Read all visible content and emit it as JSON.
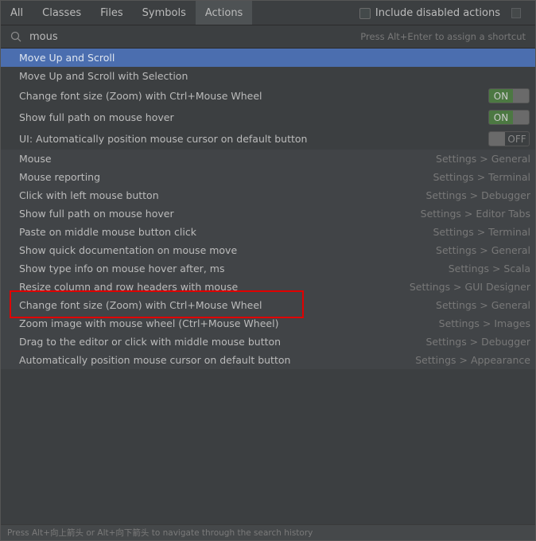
{
  "tabs": [
    "All",
    "Classes",
    "Files",
    "Symbols",
    "Actions"
  ],
  "active_tab": "Actions",
  "include_disabled": {
    "label": "Include disabled actions",
    "checked": false
  },
  "search": {
    "value": "mous",
    "hint": "Press Alt+Enter to assign a shortcut"
  },
  "actions": [
    {
      "label": "Move Up and Scroll",
      "selected": true
    },
    {
      "label": "Move Up and Scroll with Selection"
    },
    {
      "label": "Change font size (Zoom) with Ctrl+Mouse Wheel",
      "toggle": "ON"
    },
    {
      "label": "Show full path on mouse hover",
      "toggle": "ON"
    },
    {
      "label": "UI: Automatically position mouse cursor on default button",
      "toggle": "OFF"
    }
  ],
  "settings": [
    {
      "label": "Mouse",
      "location": "Settings > General"
    },
    {
      "label": "Mouse reporting",
      "location": "Settings > Terminal"
    },
    {
      "label": "Click with left mouse button",
      "location": "Settings > Debugger"
    },
    {
      "label": "Show full path on mouse hover",
      "location": "Settings > Editor Tabs"
    },
    {
      "label": "Paste on middle mouse button click",
      "location": "Settings > Terminal"
    },
    {
      "label": "Show quick documentation on mouse move",
      "location": "Settings > General"
    },
    {
      "label": "Show type info on mouse hover after, ms",
      "location": "Settings > Scala"
    },
    {
      "label": "Resize column and row headers with mouse",
      "location": "Settings > GUI Designer"
    },
    {
      "label": "Change font size (Zoom) with Ctrl+Mouse Wheel",
      "location": "Settings > General",
      "highlighted": true
    },
    {
      "label": "Zoom image with mouse wheel (Ctrl+Mouse Wheel)",
      "location": "Settings > Images"
    },
    {
      "label": "Drag to the editor or click with middle mouse button",
      "location": "Settings > Debugger"
    },
    {
      "label": "Automatically position mouse cursor on default button",
      "location": "Settings > Appearance"
    }
  ],
  "footer": "Press Alt+向上箭头 or Alt+向下箭头 to navigate through the search history",
  "colors": {
    "selection": "#4b6eaf",
    "toggle_on": "#4c7842",
    "highlight_box": "#e00000"
  }
}
